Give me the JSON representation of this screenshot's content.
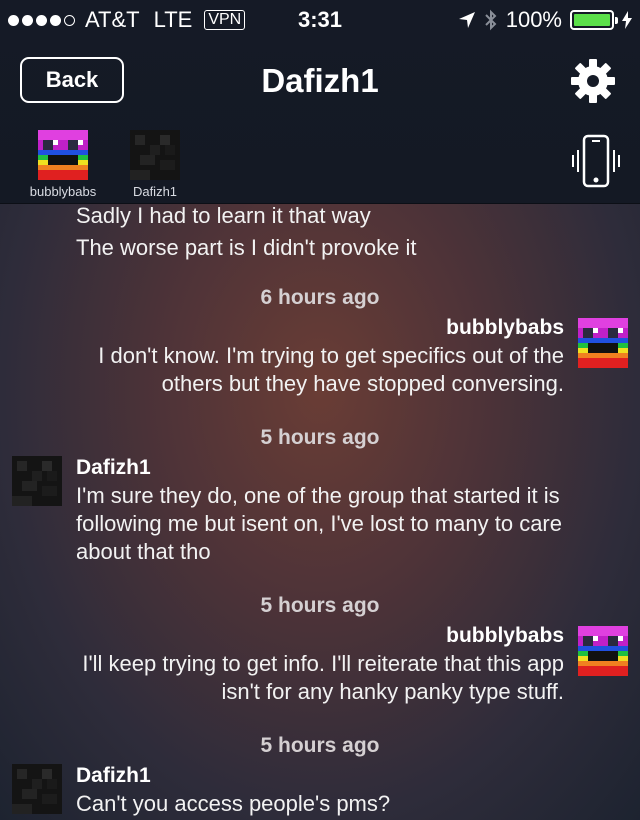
{
  "status_bar": {
    "carrier": "AT&T",
    "network": "LTE",
    "vpn": "VPN",
    "time": "3:31",
    "battery": "100%"
  },
  "nav": {
    "back_label": "Back",
    "title": "Dafizh1"
  },
  "members": [
    {
      "name": "bubblybabs"
    },
    {
      "name": "Dafizh1"
    }
  ],
  "messages": {
    "m0": {
      "lines": [
        "Sadly I had to learn it that way",
        "The worse part is I didn't provoke it"
      ]
    },
    "ts1": "6 hours ago",
    "m1": {
      "sender": "bubblybabs",
      "lines": [
        "I don't know.  I'm trying to get specifics out of the",
        "others but they have stopped conversing."
      ]
    },
    "ts2": "5 hours ago",
    "m2": {
      "sender": "Dafizh1",
      "lines": [
        "I'm sure they do, one of the group that started it is",
        "following me but isent on, I've lost to many to care",
        "about that tho"
      ]
    },
    "ts3": "5 hours ago",
    "m3": {
      "sender": "bubblybabs",
      "lines": [
        "I'll keep trying to get info.  I'll reiterate that this app",
        "isn't for any hanky panky type stuff."
      ]
    },
    "ts4": "5 hours ago",
    "m4": {
      "sender": "Dafizh1",
      "lines": [
        "Can't you access people's pms?"
      ]
    }
  }
}
